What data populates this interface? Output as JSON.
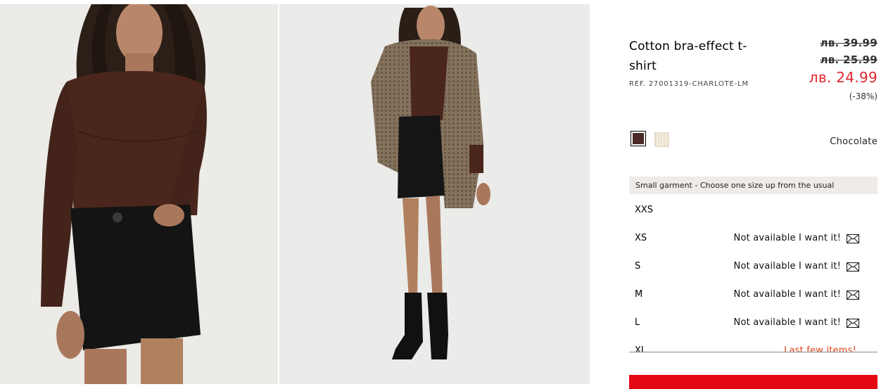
{
  "product": {
    "title": "Cotton bra-effect t-shirt",
    "ref": "REF. 27001319-CHARLOTE-LM",
    "price_original": "лв. 39.99",
    "price_previous": "лв. 25.99",
    "price_current": "лв. 24.99",
    "discount": "(-38%)"
  },
  "colors": {
    "selected_name": "Chocolate",
    "swatches": [
      {
        "name": "chocolate",
        "hex": "#4a2a26"
      },
      {
        "name": "beige",
        "hex": "#ede6d3"
      }
    ]
  },
  "size_notice": "Small garment - Choose one size up from the usual",
  "sizes": [
    {
      "label": "XXS",
      "status": ""
    },
    {
      "label": "XS",
      "status": "Not available I want it!"
    },
    {
      "label": "S",
      "status": "Not available I want it!"
    },
    {
      "label": "M",
      "status": "Not available I want it!"
    },
    {
      "label": "L",
      "status": "Not available I want it!"
    },
    {
      "label": "XL",
      "status": "Last few items!"
    }
  ],
  "theme": {
    "sale_red": "#e0272f",
    "button_red": "#e30613",
    "last_items_orange": "#e0461d"
  }
}
